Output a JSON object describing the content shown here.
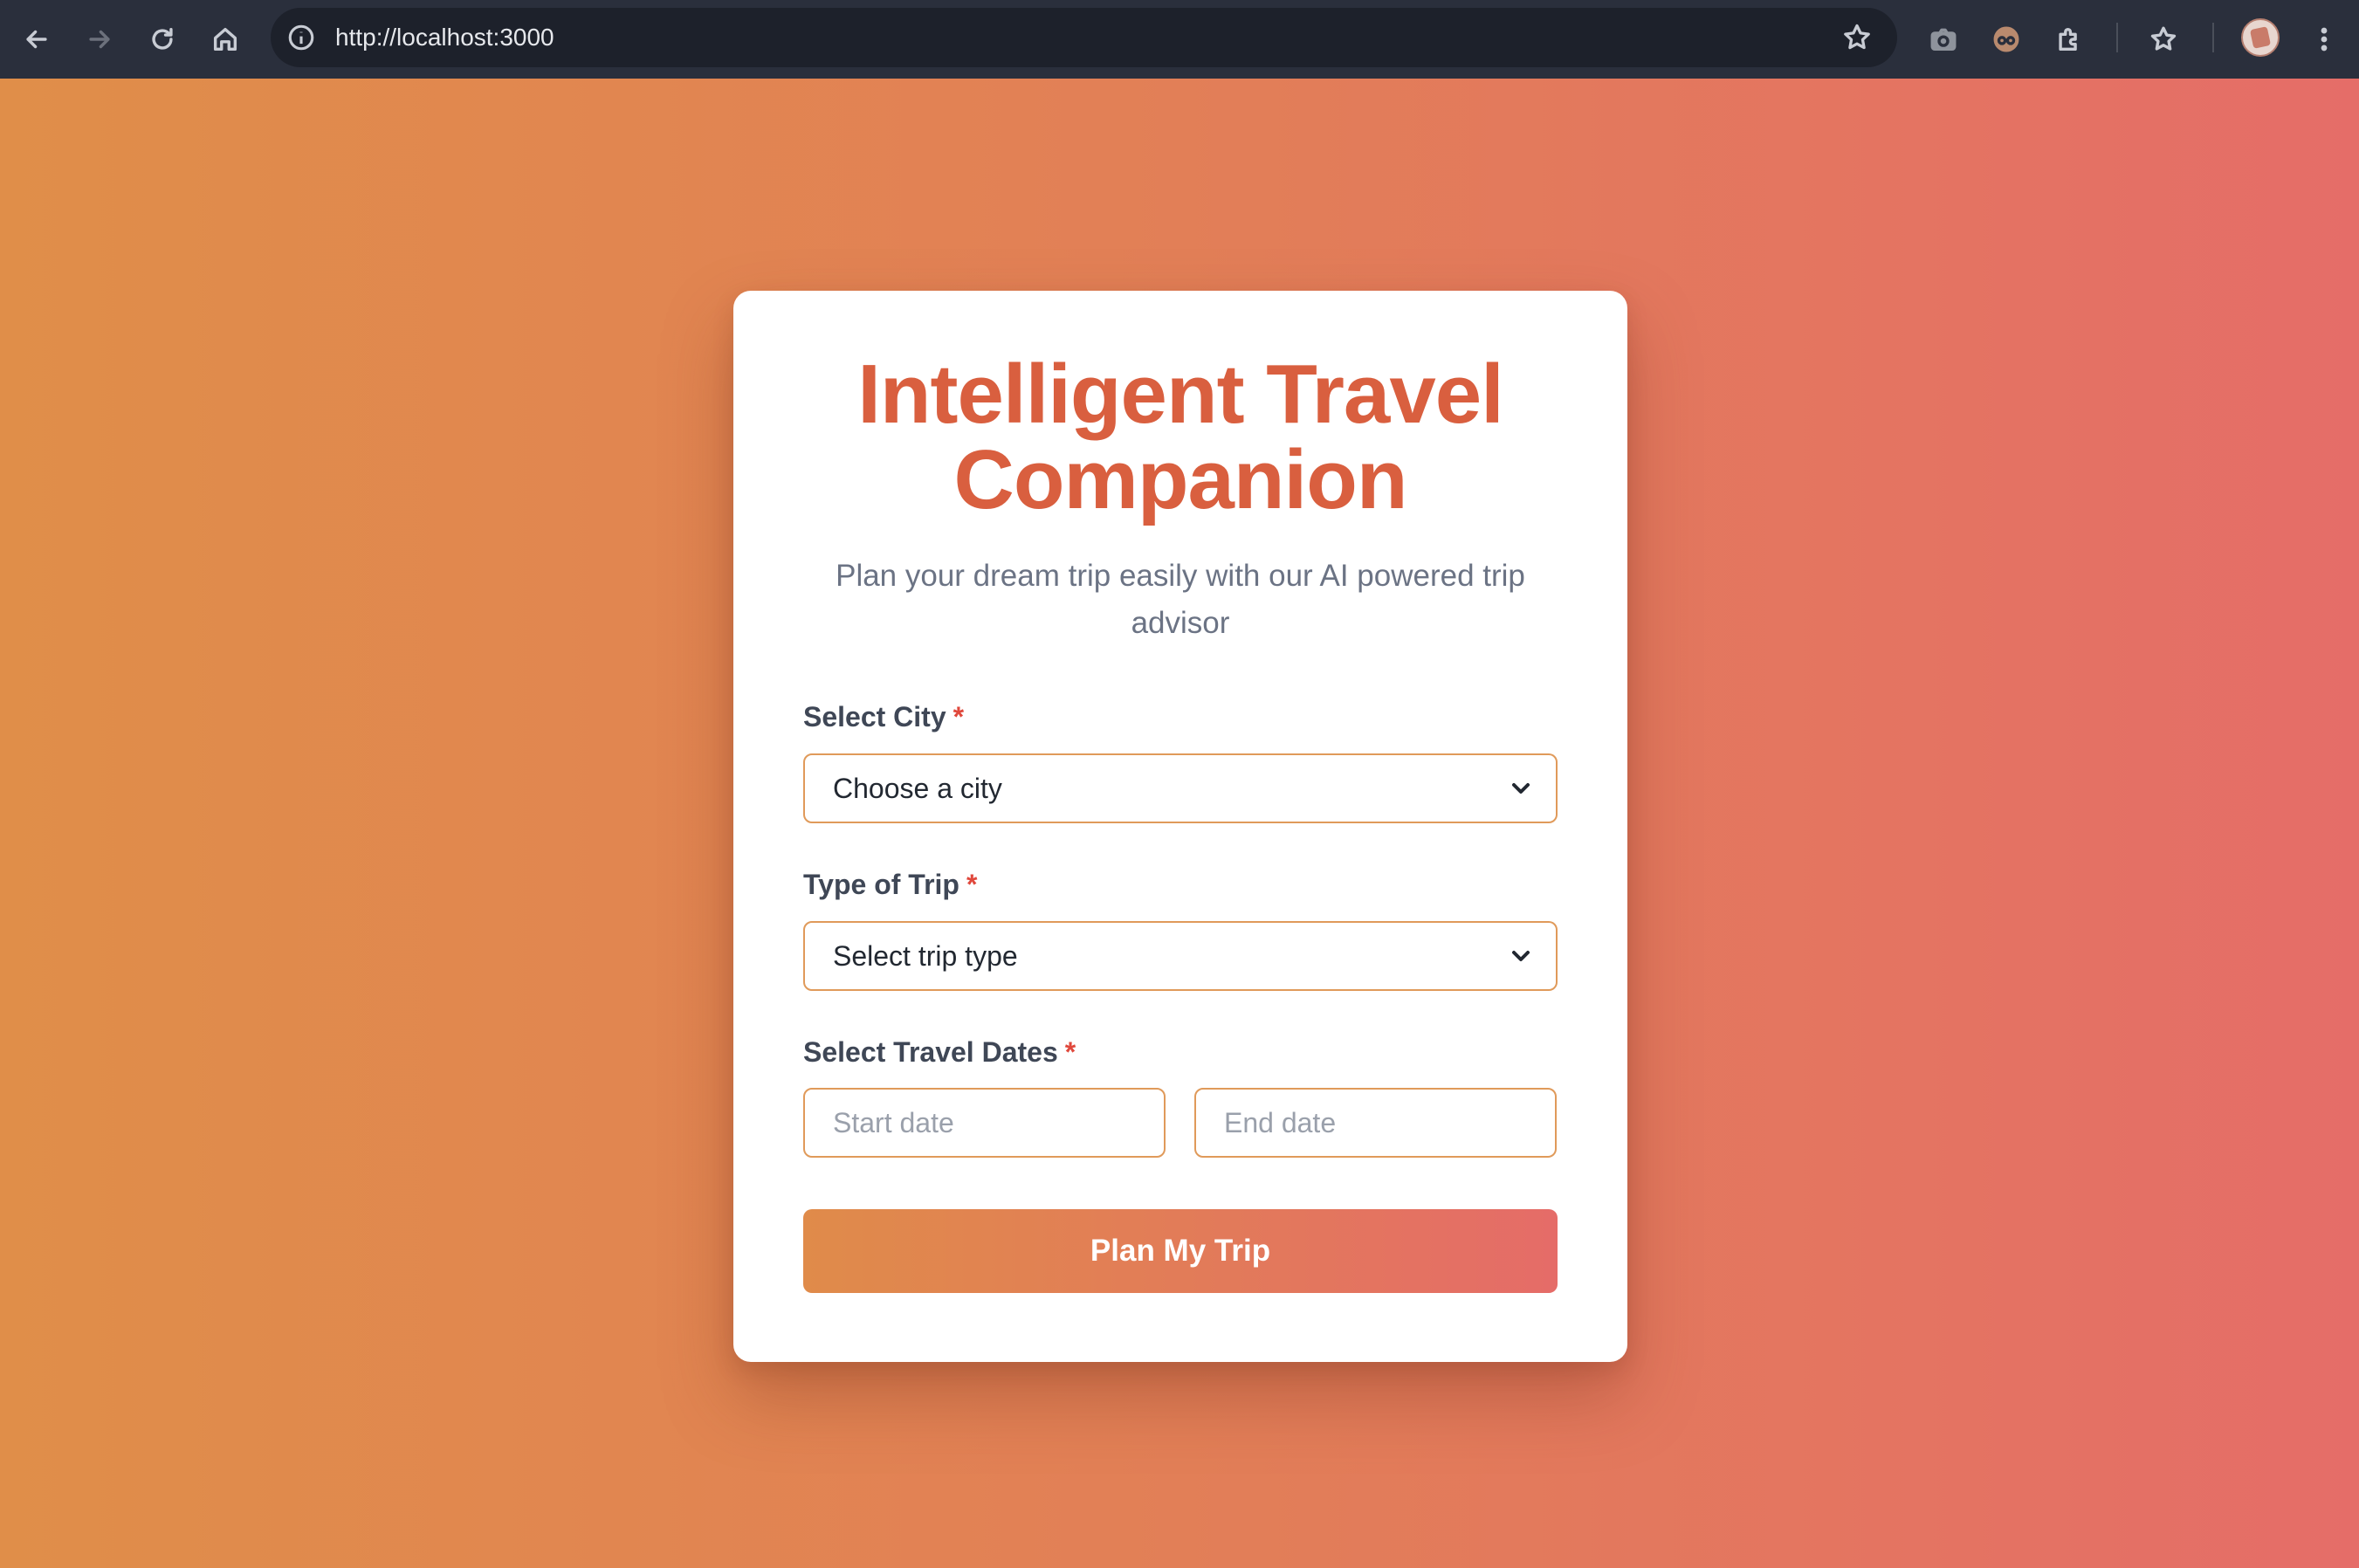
{
  "browser": {
    "url": "http://localhost:3000"
  },
  "card": {
    "title_line1": "Intelligent Travel",
    "title_line2": "Companion",
    "subtitle": "Plan your dream trip easily with our AI powered trip advisor"
  },
  "form": {
    "city_label": "Select City",
    "city_value": "Choose a city",
    "trip_label": "Type of Trip",
    "trip_value": "Select trip type",
    "dates_label": "Select Travel Dates",
    "start_placeholder": "Start date",
    "end_placeholder": "End date",
    "required_marker": "*",
    "submit_label": "Plan My Trip"
  },
  "colors": {
    "accent_start": "#e08e49",
    "accent_end": "#e56d68",
    "title": "#d95f3f",
    "required": "#e0483c"
  }
}
